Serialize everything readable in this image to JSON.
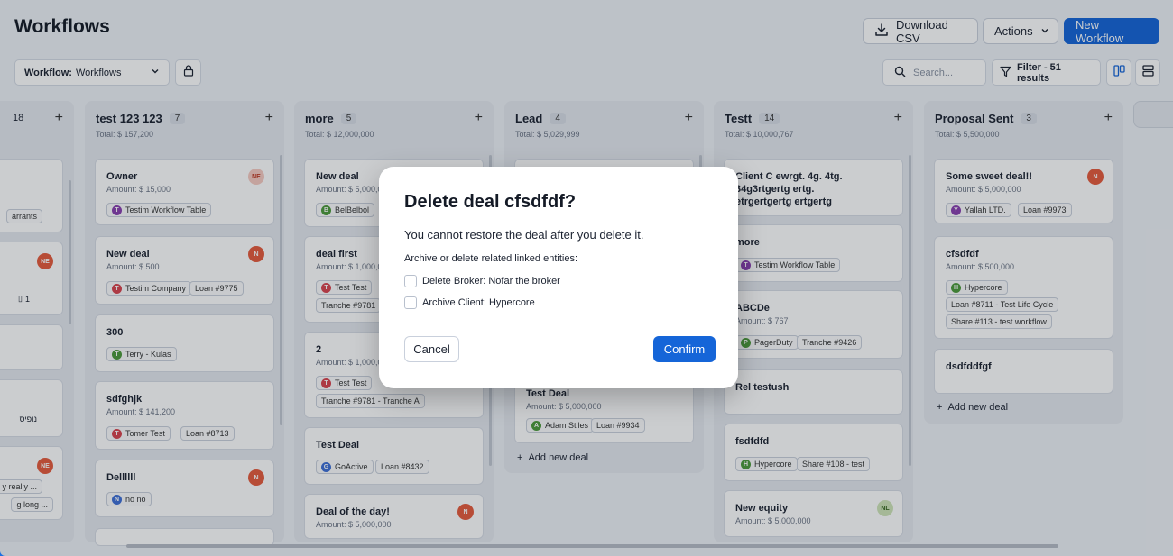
{
  "header": {
    "title": "Workflows",
    "download_csv": "Download CSV",
    "actions": "Actions",
    "new_workflow": "New Workflow"
  },
  "toolbar": {
    "workflow_label": "Workflow:",
    "workflow_value": "Workflows",
    "search_placeholder": "Search...",
    "filter": "Filter - 51 results"
  },
  "columns": [
    {
      "name": "",
      "count": "18"
    },
    {
      "name": "test 123 123",
      "count": "7",
      "total": "Total: $ 157,200"
    },
    {
      "name": "more",
      "count": "5",
      "total": "Total: $ 12,000,000"
    },
    {
      "name": "Lead",
      "count": "4",
      "total": "Total: $ 5,029,999"
    },
    {
      "name": "Testt",
      "count": "14",
      "total": "Total: $ 10,000,767"
    },
    {
      "name": "Proposal Sent",
      "count": "3",
      "total": "Total: $ 5,500,000"
    }
  ],
  "col0": {
    "tag1": "arrants",
    "avatar": "NE",
    "count": "1",
    "tag2": "נופיס",
    "avatar2": "NE",
    "tag3": "y really ...",
    "tag4": "g long ..."
  },
  "col1": {
    "cards": [
      {
        "title": "Owner",
        "amount": "Amount: $ 15,000",
        "tag": "Testim Workflow Table",
        "dot": "T",
        "avatar": "NE"
      },
      {
        "title": "New deal",
        "amount": "Amount: $ 500",
        "tag": "Testim Company",
        "dot": "T",
        "loan": "Loan #9775",
        "avatar": "N"
      },
      {
        "title": "300",
        "tag": "Terry - Kulas",
        "dot": "T"
      },
      {
        "title": "sdfghjk",
        "amount": "Amount: $ 141,200",
        "tag": "Tomer Test",
        "dot": "T",
        "loan": "Loan #8713"
      },
      {
        "title": "Dellllll",
        "tag": "no no",
        "dot": "N",
        "avatar": "N"
      }
    ]
  },
  "col2": {
    "cards": [
      {
        "title": "New deal",
        "amount": "Amount: $ 5,000,0",
        "tag": "BelBelbol",
        "dot": "B"
      },
      {
        "title": "deal first",
        "amount": "Amount: $ 1,000,0",
        "tag": "Test Test",
        "dot": "T",
        "tranche": "Tranche #9781"
      },
      {
        "title": "2",
        "amount": "Amount: $ 1,000,0",
        "tag": "Test Test",
        "dot": "T",
        "tranche": "Tranche #9781 - Tranche A"
      },
      {
        "title": "Test Deal",
        "tag": "GoActive",
        "dot": "G",
        "loan": "Loan #8432"
      },
      {
        "title": "Deal of the day!",
        "amount": "Amount: $ 5,000,000",
        "avatar": "N"
      }
    ]
  },
  "col3": {
    "card_title": "Test Deal",
    "card_amount": "Amount: $ 5,000,000",
    "tag": "Adam Stiles",
    "dot": "A",
    "loan": "Loan #9934",
    "add_new": "Add new deal"
  },
  "col4": {
    "cards": [
      {
        "title": "Client C ewrgt. 4g. 4tg.",
        "title2": "34g3rtgertg ertg.",
        "title3": "etrgertgertg ertgertg"
      },
      {
        "title": "more",
        "tag": "Testim Workflow Table",
        "dot": "T"
      },
      {
        "title": "ABCDe",
        "amount": "Amount: $ 767",
        "tag": "PagerDuty",
        "dot": "P",
        "tranche": "Tranche #9426"
      },
      {
        "title": "Rel testush"
      },
      {
        "title": "fsdfdfd",
        "tag": "Hypercore",
        "dot": "H",
        "share": "Share #108 - test"
      },
      {
        "title": "New equity",
        "amount": "Amount: $ 5,000,000",
        "avatar": "NL"
      }
    ]
  },
  "col5": {
    "cards": [
      {
        "title": "Some sweet deal!!",
        "amount": "Amount: $ 5,000,000",
        "tag": "Yallah LTD.",
        "dot": "Y",
        "loan": "Loan #9973",
        "avatar": "N"
      },
      {
        "title": "cfsdfdf",
        "amount": "Amount: $ 500,000",
        "tag": "Hypercore",
        "dot": "H",
        "loan": "Loan #8711 - Test Life Cycle",
        "share": "Share #113 - test workflow"
      },
      {
        "title": "dsdfddfgf"
      }
    ],
    "add_new": "Add new deal"
  },
  "modal": {
    "title": "Delete deal cfsdfdf?",
    "description": "You cannot restore the deal after you delete it.",
    "subtitle": "Archive or delete related linked entities:",
    "option1": "Delete Broker: Nofar the broker",
    "option2": "Archive Client: Hypercore",
    "cancel": "Cancel",
    "confirm": "Confirm"
  },
  "colors": {
    "primary": "#1565d8",
    "avatar_red": "#e65a3b",
    "avatar_green": "#cfe5b8",
    "dot_red": "#d9434e",
    "dot_purple": "#8a3fb0",
    "dot_green": "#4c9a3a",
    "dot_blue": "#3e6fd6"
  }
}
